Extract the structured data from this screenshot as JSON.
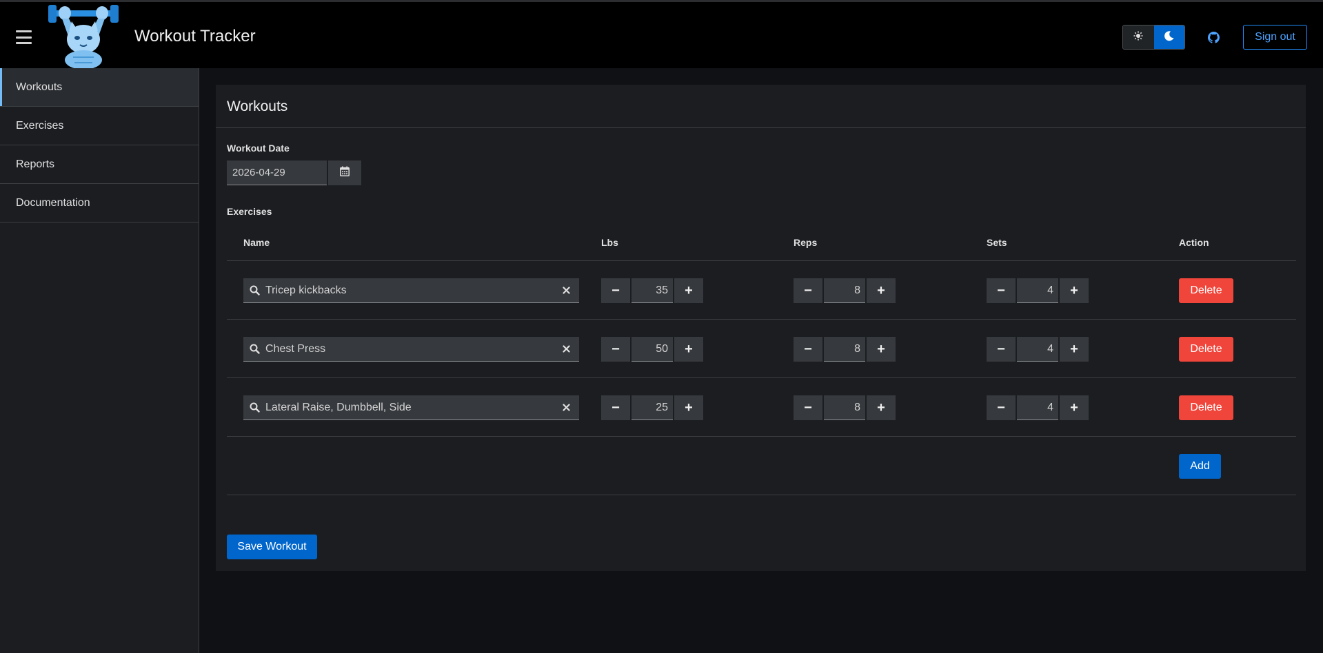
{
  "header": {
    "title": "Workout Tracker",
    "sign_out_label": "Sign out",
    "theme": "dark"
  },
  "sidebar": {
    "items": [
      {
        "label": "Workouts",
        "active": true
      },
      {
        "label": "Exercises",
        "active": false
      },
      {
        "label": "Reports",
        "active": false
      },
      {
        "label": "Documentation",
        "active": false
      }
    ]
  },
  "main": {
    "title": "Workouts",
    "workout_date_label": "Workout Date",
    "workout_date": "2026-04-29",
    "exercises_label": "Exercises",
    "columns": [
      "Name",
      "Lbs",
      "Reps",
      "Sets",
      "Action"
    ],
    "rows": [
      {
        "name": "Tricep kickbacks",
        "lbs": "35",
        "reps": "8",
        "sets": "4"
      },
      {
        "name": "Chest Press",
        "lbs": "50",
        "reps": "8",
        "sets": "4"
      },
      {
        "name": "Lateral Raise, Dumbbell, Side",
        "lbs": "25",
        "reps": "8",
        "sets": "4"
      }
    ],
    "delete_label": "Delete",
    "add_label": "Add",
    "save_label": "Save Workout"
  },
  "icons": {
    "menu": "hamburger-icon",
    "logo": "logo-cat-dumbbell",
    "light_theme": "sun-icon",
    "dark_theme": "moon-icon",
    "github": "github-icon",
    "calendar": "calendar-icon",
    "search": "search-icon",
    "clear": "close-icon",
    "decrement": "minus-icon",
    "increment": "plus-icon"
  },
  "colors": {
    "primary": "#0066cc",
    "danger": "#f0453a",
    "active_indicator": "#73bcf7",
    "header_bg": "#000000",
    "sidebar_bg": "#1b1d21",
    "page_bg": "#0f1114"
  }
}
